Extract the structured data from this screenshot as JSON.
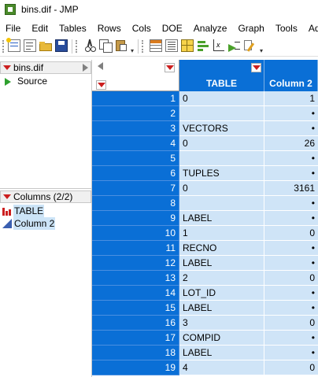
{
  "window": {
    "title": "bins.dif - JMP"
  },
  "menu": [
    "File",
    "Edit",
    "Tables",
    "Rows",
    "Cols",
    "DOE",
    "Analyze",
    "Graph",
    "Tools",
    "Add-"
  ],
  "toolbar": {
    "icons": [
      "new-data-table-icon",
      "new-script-icon",
      "open-icon",
      "save-icon",
      "cut-icon",
      "copy-icon",
      "paste-icon",
      "data-table-icon",
      "journal-icon",
      "grid-icon",
      "distribution-icon",
      "fit-y-by-x-icon",
      "fit-model-icon",
      "annotate-icon"
    ]
  },
  "table_panel": {
    "name": "bins.dif",
    "source_label": "Source"
  },
  "columns_panel": {
    "header": "Columns (2/2)",
    "columns": [
      {
        "name": "TABLE",
        "type_icon": "nominal-bar-icon"
      },
      {
        "name": "Column 2",
        "type_icon": "continuous-triangle-icon"
      }
    ]
  },
  "grid": {
    "headers": [
      "TABLE",
      "Column 2"
    ],
    "rows": [
      {
        "n": "1",
        "c1": "0",
        "c2": "1"
      },
      {
        "n": "2",
        "c1": "",
        "c2": "•"
      },
      {
        "n": "3",
        "c1": "VECTORS",
        "c2": "•"
      },
      {
        "n": "4",
        "c1": "0",
        "c2": "26"
      },
      {
        "n": "5",
        "c1": "",
        "c2": "•"
      },
      {
        "n": "6",
        "c1": "TUPLES",
        "c2": "•"
      },
      {
        "n": "7",
        "c1": "0",
        "c2": "3161"
      },
      {
        "n": "8",
        "c1": "",
        "c2": "•"
      },
      {
        "n": "9",
        "c1": "LABEL",
        "c2": "•"
      },
      {
        "n": "10",
        "c1": "1",
        "c2": "0"
      },
      {
        "n": "11",
        "c1": "RECNO",
        "c2": "•"
      },
      {
        "n": "12",
        "c1": "LABEL",
        "c2": "•"
      },
      {
        "n": "13",
        "c1": "2",
        "c2": "0"
      },
      {
        "n": "14",
        "c1": "LOT_ID",
        "c2": "•"
      },
      {
        "n": "15",
        "c1": "LABEL",
        "c2": "•"
      },
      {
        "n": "16",
        "c1": "3",
        "c2": "0"
      },
      {
        "n": "17",
        "c1": "COMPID",
        "c2": "•"
      },
      {
        "n": "18",
        "c1": "LABEL",
        "c2": "•"
      },
      {
        "n": "19",
        "c1": "4",
        "c2": "0"
      }
    ]
  }
}
